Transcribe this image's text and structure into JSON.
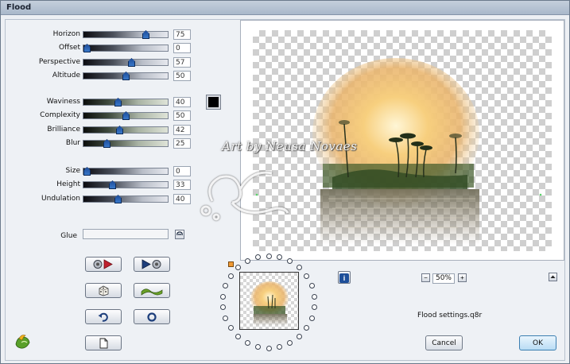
{
  "window": {
    "title": "Flood"
  },
  "sliders": [
    {
      "id": "horizon",
      "label": "Horizon",
      "value": "75",
      "pos": 0.75,
      "group": 1
    },
    {
      "id": "offset",
      "label": "Offset",
      "value": "0",
      "pos": 0.0,
      "group": 1
    },
    {
      "id": "perspective",
      "label": "Perspective",
      "value": "57",
      "pos": 0.57,
      "group": 1
    },
    {
      "id": "altitude",
      "label": "Altitude",
      "value": "50",
      "pos": 0.5,
      "group": 1
    },
    {
      "id": "waviness",
      "label": "Waviness",
      "value": "40",
      "pos": 0.4,
      "group": 2
    },
    {
      "id": "complexity",
      "label": "Complexity",
      "value": "50",
      "pos": 0.5,
      "group": 2
    },
    {
      "id": "brilliance",
      "label": "Brilliance",
      "value": "42",
      "pos": 0.42,
      "group": 2
    },
    {
      "id": "blur",
      "label": "Blur",
      "value": "25",
      "pos": 0.25,
      "group": 2
    },
    {
      "id": "size",
      "label": "Size",
      "value": "0",
      "pos": 0.0,
      "group": 3
    },
    {
      "id": "height",
      "label": "Height",
      "value": "33",
      "pos": 0.33,
      "group": 3
    },
    {
      "id": "undulation",
      "label": "Undulation",
      "value": "40",
      "pos": 0.4,
      "group": 3
    }
  ],
  "color": {
    "value": "#000000"
  },
  "glue": {
    "label": "Glue",
    "value": ""
  },
  "zoom": {
    "value": "50%",
    "minus": "−",
    "plus": "+"
  },
  "settings_file": "Flood settings.q8r",
  "buttons": {
    "cancel": "Cancel",
    "ok": "OK"
  },
  "watermark": "Art by  Neusa Novaes",
  "info_glyph": "i"
}
